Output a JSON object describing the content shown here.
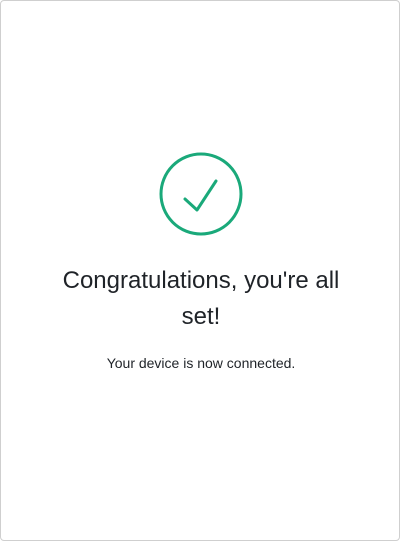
{
  "dialog": {
    "icon": "check-circle-icon",
    "accent_color": "#1aa97a",
    "title": "Congratulations, you're all set!",
    "message": "Your device is now connected."
  }
}
